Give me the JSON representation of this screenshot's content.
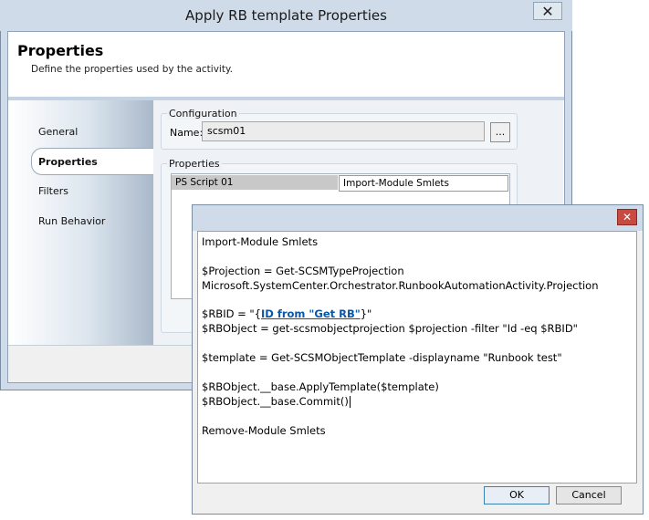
{
  "main_window": {
    "title": "Apply RB template Properties",
    "close_glyph": "✕",
    "header": {
      "title": "Properties",
      "description": "Define the properties used by the activity."
    },
    "sidebar": {
      "items": [
        {
          "label": "General"
        },
        {
          "label": "Properties",
          "selected": true
        },
        {
          "label": "Filters"
        },
        {
          "label": "Run Behavior"
        }
      ]
    },
    "configuration": {
      "group_label": "Configuration",
      "name_label": "Name:",
      "name_value": "scsm01",
      "browse_label": "..."
    },
    "properties": {
      "group_label": "Properties",
      "rows": [
        {
          "name": "PS Script 01",
          "value": "Import-Module Smlets"
        }
      ]
    }
  },
  "dialog": {
    "close_glyph": "✕",
    "script": {
      "line1": "Import-Module Smlets",
      "line2": "$Projection = Get-SCSMTypeProjection",
      "line3": "Microsoft.SystemCenter.Orchestrator.RunbookAutomationActivity.Projection",
      "line4_prefix": "$RBID = \"{",
      "line4_token": "ID from \"Get RB\"",
      "line4_suffix": "}\"",
      "line5": "$RBObject = get-scsmobjectprojection $projection -filter \"Id -eq $RBID\"",
      "line6": "$template = Get-SCSMObjectTemplate -displayname \"Runbook test\"",
      "line7": "$RBObject.__base.ApplyTemplate($template)",
      "line8": "$RBObject.__base.Commit()",
      "line9": "Remove-Module Smlets"
    },
    "ok_label": "OK",
    "cancel_label": "Cancel"
  },
  "colors": {
    "titlebar": "#cfdbe8",
    "dialog_close": "#c94a40",
    "published_data_token": "#0b57a6"
  }
}
